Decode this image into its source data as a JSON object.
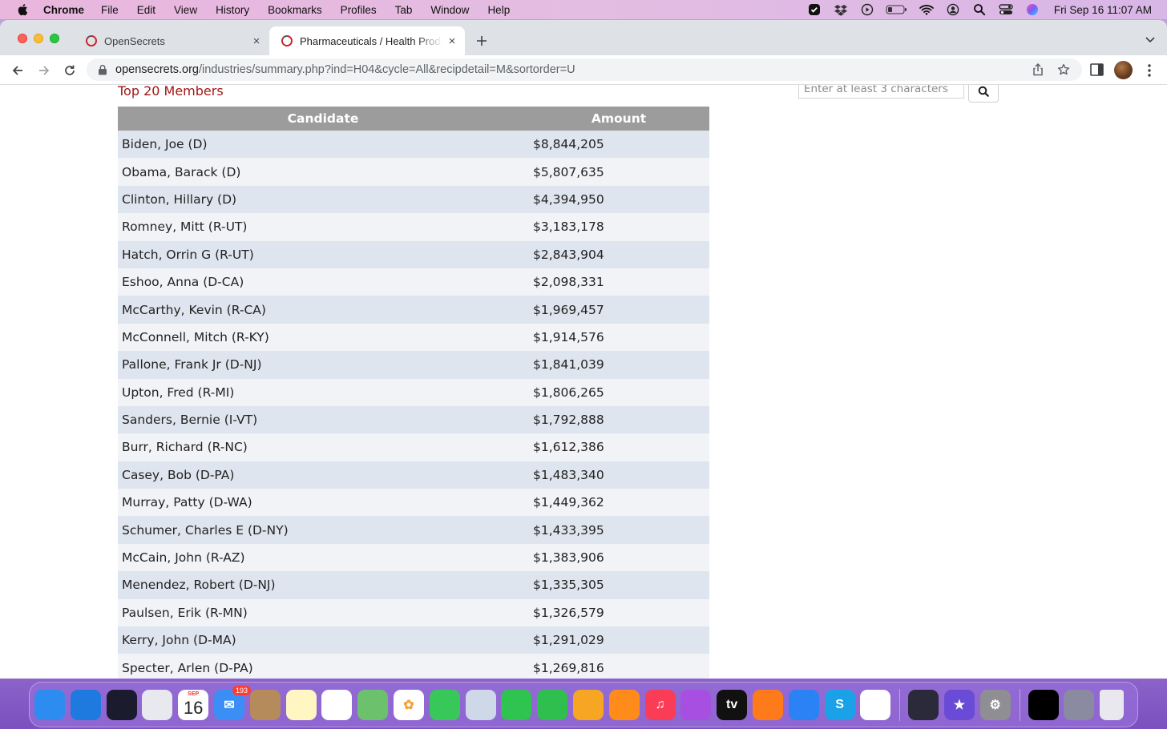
{
  "menubar": {
    "app": "Chrome",
    "items": [
      "File",
      "Edit",
      "View",
      "History",
      "Bookmarks",
      "Profiles",
      "Tab",
      "Window",
      "Help"
    ],
    "clock": "Fri Sep 16  11:07 AM",
    "status_icons": [
      "check-icon",
      "dropbox-icon",
      "play-icon",
      "battery-icon",
      "wifi-icon",
      "user-icon",
      "spotlight-icon",
      "control-center-icon",
      "siri-icon"
    ]
  },
  "tabs": [
    {
      "title": "OpenSecrets",
      "close": "×",
      "active": false
    },
    {
      "title": "Pharmaceuticals / Health Products",
      "close": "×",
      "active": true
    }
  ],
  "address": {
    "host": "opensecrets.org",
    "path": "/industries/summary.php?ind=H04&cycle=All&recipdetail=M&sortorder=U"
  },
  "page": {
    "section_title": "Top 20 Members",
    "search_placeholder": "Enter at least 3 characters",
    "table": {
      "headers": [
        "Candidate",
        "Amount"
      ],
      "rows": [
        [
          "Biden, Joe (D)",
          "$8,844,205"
        ],
        [
          "Obama, Barack (D)",
          "$5,807,635"
        ],
        [
          "Clinton, Hillary (D)",
          "$4,394,950"
        ],
        [
          "Romney, Mitt (R-UT)",
          "$3,183,178"
        ],
        [
          "Hatch, Orrin G (R-UT)",
          "$2,843,904"
        ],
        [
          "Eshoo, Anna (D-CA)",
          "$2,098,331"
        ],
        [
          "McCarthy, Kevin (R-CA)",
          "$1,969,457"
        ],
        [
          "McConnell, Mitch (R-KY)",
          "$1,914,576"
        ],
        [
          "Pallone, Frank Jr (D-NJ)",
          "$1,841,039"
        ],
        [
          "Upton, Fred (R-MI)",
          "$1,806,265"
        ],
        [
          "Sanders, Bernie (I-VT)",
          "$1,792,888"
        ],
        [
          "Burr, Richard (R-NC)",
          "$1,612,386"
        ],
        [
          "Casey, Bob (D-PA)",
          "$1,483,340"
        ],
        [
          "Murray, Patty (D-WA)",
          "$1,449,362"
        ],
        [
          "Schumer, Charles E (D-NY)",
          "$1,433,395"
        ],
        [
          "McCain, John (R-AZ)",
          "$1,383,906"
        ],
        [
          "Menendez, Robert (D-NJ)",
          "$1,335,305"
        ],
        [
          "Paulsen, Erik (R-MN)",
          "$1,326,579"
        ],
        [
          "Kerry, John (D-MA)",
          "$1,291,029"
        ],
        [
          "Specter, Arlen (D-PA)",
          "$1,269,816"
        ]
      ]
    }
  },
  "dock": {
    "apps": [
      {
        "name": "finder",
        "color": "#2d8cf0",
        "glyph": ""
      },
      {
        "name": "safari",
        "color": "#1f7ae0",
        "glyph": ""
      },
      {
        "name": "siri",
        "color": "#1b1b2e",
        "glyph": ""
      },
      {
        "name": "launchpad",
        "color": "#e8e8ef",
        "glyph": ""
      },
      {
        "name": "calendar",
        "color": "#ffffff",
        "glyph": ""
      },
      {
        "name": "mail",
        "color": "#3a8ef5",
        "glyph": "✉"
      },
      {
        "name": "contacts",
        "color": "#b58b5c",
        "glyph": ""
      },
      {
        "name": "notes",
        "color": "#fff6c2",
        "glyph": ""
      },
      {
        "name": "reminders",
        "color": "#ffffff",
        "glyph": ""
      },
      {
        "name": "maps",
        "color": "#6cc26c",
        "glyph": ""
      },
      {
        "name": "photos",
        "color": "#ffffff",
        "glyph": "✿"
      },
      {
        "name": "messages",
        "color": "#38c759",
        "glyph": ""
      },
      {
        "name": "preview",
        "color": "#cfd8e8",
        "glyph": ""
      },
      {
        "name": "facetime",
        "color": "#2fc34f",
        "glyph": ""
      },
      {
        "name": "numbers",
        "color": "#2fbf4f",
        "glyph": ""
      },
      {
        "name": "pages",
        "color": "#f6a623",
        "glyph": ""
      },
      {
        "name": "books",
        "color": "#ff8c1a",
        "glyph": ""
      },
      {
        "name": "music",
        "color": "#fb3c56",
        "glyph": "♫"
      },
      {
        "name": "podcasts",
        "color": "#a64fe0",
        "glyph": ""
      },
      {
        "name": "tv",
        "color": "#111111",
        "glyph": "tv"
      },
      {
        "name": "firefox",
        "color": "#ff7a1a",
        "glyph": ""
      },
      {
        "name": "keynote",
        "color": "#2b82f5",
        "glyph": ""
      },
      {
        "name": "skype",
        "color": "#1aa1e8",
        "glyph": "S"
      },
      {
        "name": "chrome",
        "color": "#ffffff",
        "glyph": ""
      },
      {
        "name": "quicktime",
        "color": "#2a2a3a",
        "glyph": ""
      },
      {
        "name": "imovie",
        "color": "#6a4bd6",
        "glyph": "★"
      },
      {
        "name": "system-preferences",
        "color": "#8e8e93",
        "glyph": "⚙"
      }
    ],
    "calendar": {
      "month": "SEP",
      "day": "16"
    },
    "mail_badge": "193"
  }
}
